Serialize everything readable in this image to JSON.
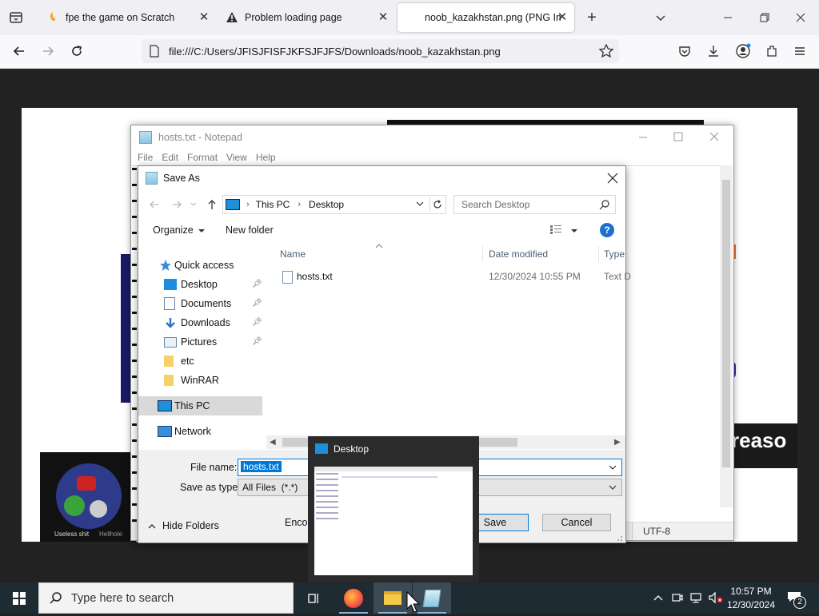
{
  "browser": {
    "tabs": [
      {
        "label": "fpe the game on Scratch",
        "icon": "scratch-icon"
      },
      {
        "label": "Problem loading page",
        "icon": "warning-icon"
      },
      {
        "label": "noob_kazakhstan.png (PNG Im",
        "icon": "image-icon"
      }
    ],
    "url": "file:///C:/Users/JFISJFISFJKFSJFJFS/Downloads/noob_kazakhstan.png"
  },
  "page": {
    "overlay_text": "reaso",
    "card_labels": [
      "Useless shit",
      "Hellhole"
    ]
  },
  "notepad": {
    "title": "hosts.txt - Notepad",
    "menu": [
      "File",
      "Edit",
      "Format",
      "View",
      "Help"
    ],
    "status_encoding": "UTF-8"
  },
  "saveas": {
    "title": "Save As",
    "breadcrumb": [
      "This PC",
      "Desktop"
    ],
    "search_placeholder": "Search Desktop",
    "organize_label": "Organize",
    "new_folder_label": "New folder",
    "nav": {
      "quick_access": "Quick access",
      "items": [
        {
          "label": "Desktop",
          "pinned": true
        },
        {
          "label": "Documents",
          "pinned": true
        },
        {
          "label": "Downloads",
          "pinned": true
        },
        {
          "label": "Pictures",
          "pinned": true
        },
        {
          "label": "etc",
          "pinned": false
        },
        {
          "label": "WinRAR",
          "pinned": false
        }
      ],
      "this_pc": "This PC",
      "network": "Network"
    },
    "columns": {
      "name": "Name",
      "date": "Date modified",
      "type": "Type"
    },
    "files": [
      {
        "name": "hosts.txt",
        "date": "12/30/2024 10:55 PM",
        "type": "Text D"
      }
    ],
    "file_name_label": "File name:",
    "file_name_value": "hosts.txt",
    "save_type_label": "Save as type:",
    "save_type_value": "All Files  (*.*)",
    "encoding_label": "Encod",
    "save_button": "Save",
    "cancel_button": "Cancel",
    "hide_folders": "Hide Folders"
  },
  "thumbnail": {
    "title": "Desktop"
  },
  "taskbar": {
    "search_placeholder": "Type here to search",
    "time": "10:57 PM",
    "date": "12/30/2024",
    "notification_count": "2"
  },
  "colors": {
    "accent": "#0078d7",
    "selection": "#0078d7",
    "taskbar": "#1f2b33",
    "highlight_row": "#cce8ff"
  }
}
